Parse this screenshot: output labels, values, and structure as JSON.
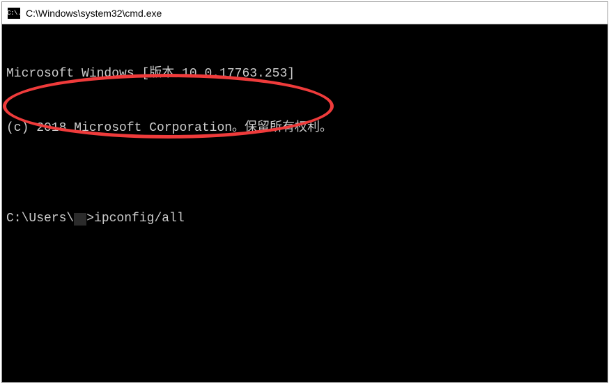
{
  "titlebar": {
    "icon_text": "C:\\.",
    "title": "C:\\Windows\\system32\\cmd.exe"
  },
  "terminal": {
    "line1": "Microsoft Windows [版本 10.0.17763.253]",
    "line2": "(c) 2018 Microsoft Corporation。保留所有权利。",
    "blank": "",
    "prompt_prefix": "C:\\Users\\",
    "prompt_suffix": ">",
    "command": "ipconfig/all"
  }
}
